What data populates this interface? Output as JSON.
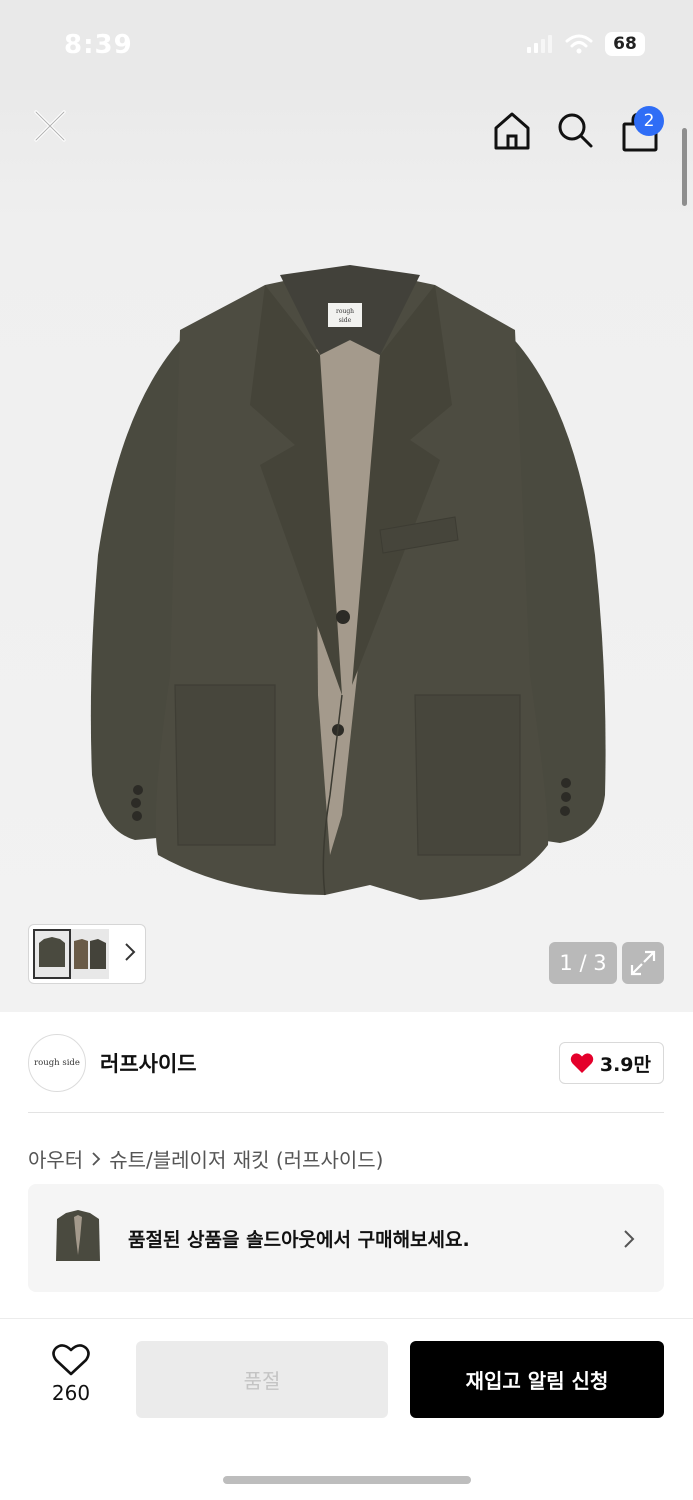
{
  "status_bar": {
    "time": "8:39",
    "battery": "68"
  },
  "header": {
    "cart_badge": "2"
  },
  "gallery": {
    "page_indicator": "1 / 3"
  },
  "brand": {
    "logo_text": "rough side",
    "name": "러프사이드",
    "like_count": "3.9만"
  },
  "breadcrumb": {
    "items": [
      "아우터",
      "슈트/블레이저 재킷 (러프사이드)"
    ]
  },
  "soldout_banner": {
    "text": "품절된 상품을 솔드아웃에서 구매해보세요."
  },
  "bottom_bar": {
    "wish_count": "260",
    "soldout_label": "품절",
    "restock_label": "재입고 알림 신청"
  },
  "product_label_text": "rough side",
  "colors": {
    "accent_blue": "#2f6df6",
    "heart_red": "#e4002b",
    "primary_black": "#000000",
    "jacket_olive": "#4b4a3f"
  },
  "icons": [
    "close-icon",
    "home-icon",
    "search-icon",
    "bag-icon",
    "expand-icon",
    "chevron-right-icon",
    "heart-icon"
  ]
}
